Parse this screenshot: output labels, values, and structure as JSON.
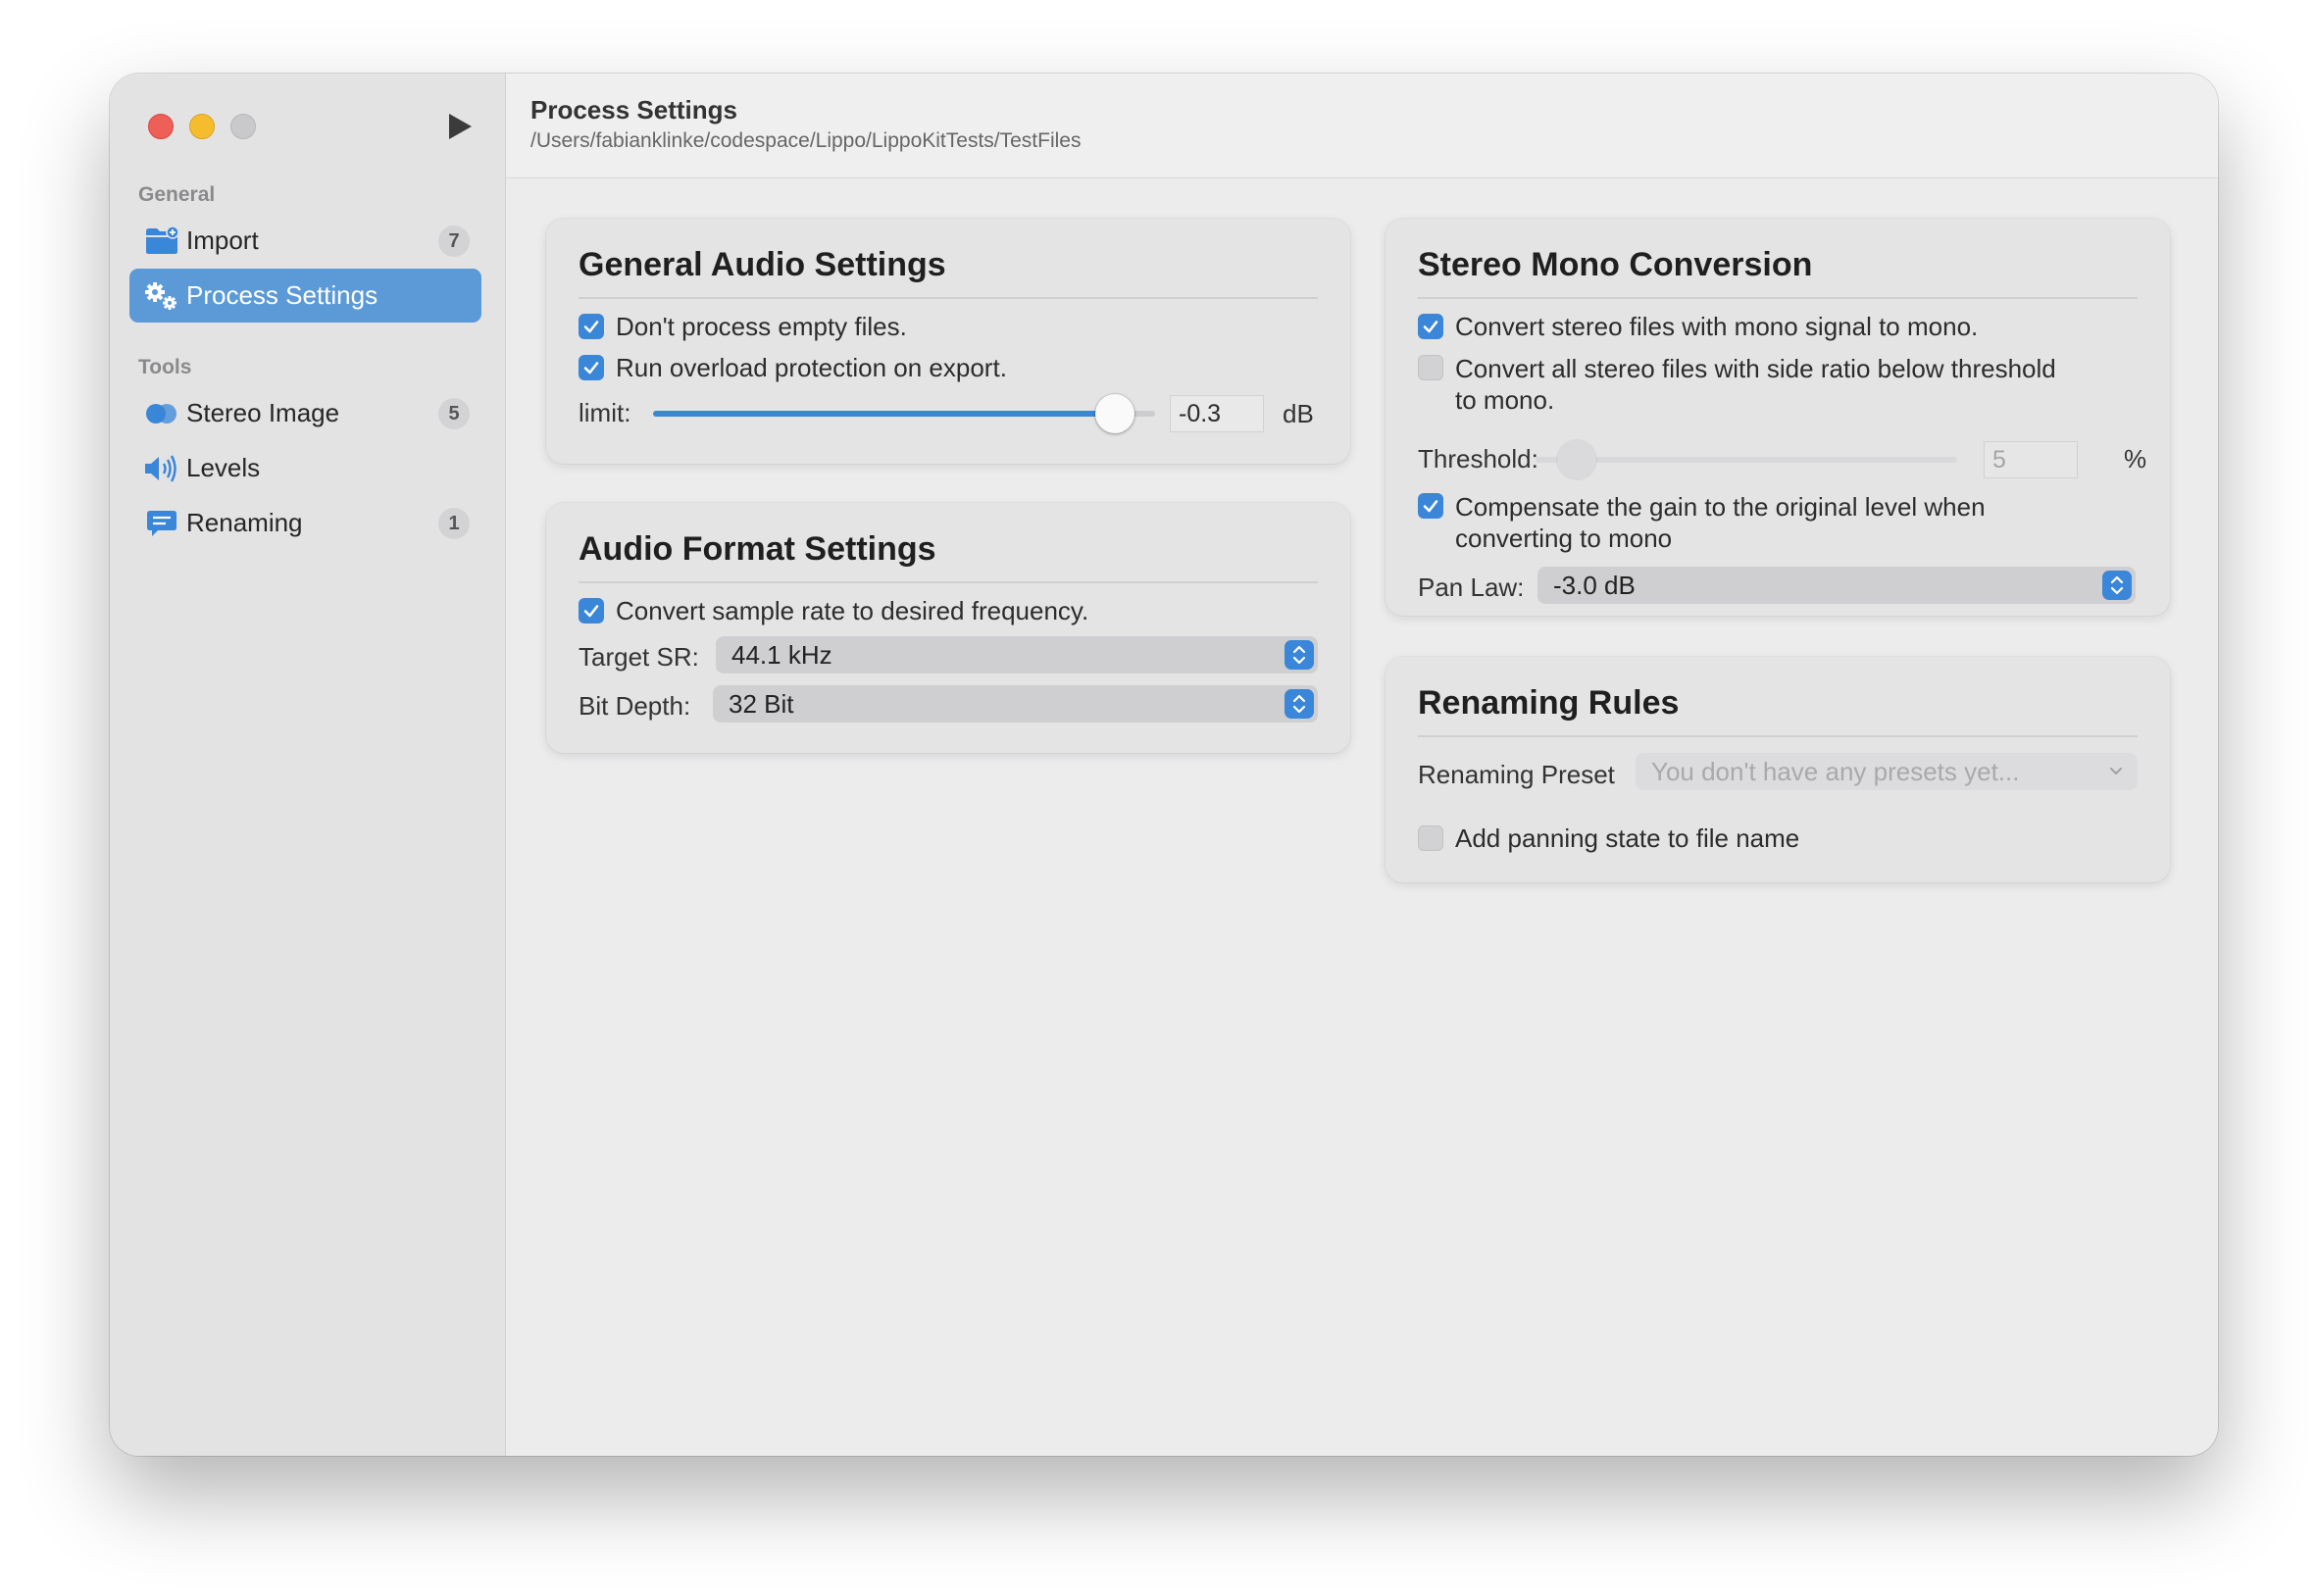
{
  "window": {
    "title": "Process Settings",
    "path": "/Users/fabianklinke/codespace/Lippo/LippoKitTests/TestFiles"
  },
  "sidebar": {
    "sections": [
      {
        "header": "General",
        "items": [
          {
            "label": "Import",
            "badge": "7",
            "icon": "folder-icon"
          },
          {
            "label": "Process Settings",
            "badge": "",
            "icon": "gears-icon",
            "selected": true
          }
        ]
      },
      {
        "header": "Tools",
        "items": [
          {
            "label": "Stereo Image",
            "badge": "5",
            "icon": "stereo-circles-icon"
          },
          {
            "label": "Levels",
            "badge": "",
            "icon": "speaker-icon"
          },
          {
            "label": "Renaming",
            "badge": "1",
            "icon": "message-icon"
          }
        ]
      }
    ]
  },
  "general_audio": {
    "title": "General Audio Settings",
    "skip_empty": {
      "label": "Don't process empty files.",
      "checked": true
    },
    "overload": {
      "label": "Run overload protection on export.",
      "checked": true
    },
    "limit": {
      "label": "limit:",
      "value": "-0.3",
      "unit": "dB",
      "slider_fraction": 0.92
    }
  },
  "audio_format": {
    "title": "Audio Format Settings",
    "convert_sr": {
      "label": "Convert sample rate to desired frequency.",
      "checked": true
    },
    "target_sr": {
      "label": "Target SR:",
      "value": "44.1 kHz"
    },
    "bit_depth": {
      "label": "Bit Depth:",
      "value": "32 Bit"
    }
  },
  "stereo_mono": {
    "title": "Stereo Mono Conversion",
    "convert_mono_signal": {
      "label": "Convert stereo files with mono signal to mono.",
      "checked": true
    },
    "convert_side_ratio": {
      "label_line1": "Convert all stereo files with side ratio below threshold",
      "label_line2": "to mono.",
      "checked": false
    },
    "threshold": {
      "label": "Threshold:",
      "value": "5",
      "unit": "%",
      "slider_fraction": 0.05
    },
    "compensate": {
      "label_line1": "Compensate the gain to the original level when",
      "label_line2": "converting to mono",
      "checked": true
    },
    "pan_law": {
      "label": "Pan Law:",
      "value": "-3.0 dB"
    }
  },
  "renaming": {
    "title": "Renaming Rules",
    "preset": {
      "label": "Renaming Preset",
      "placeholder": "You don't have any presets yet..."
    },
    "add_panning": {
      "label": "Add panning state to file name",
      "checked": false
    }
  },
  "colors": {
    "accent": "#3a86d8",
    "selection": "#5b9ad6"
  }
}
